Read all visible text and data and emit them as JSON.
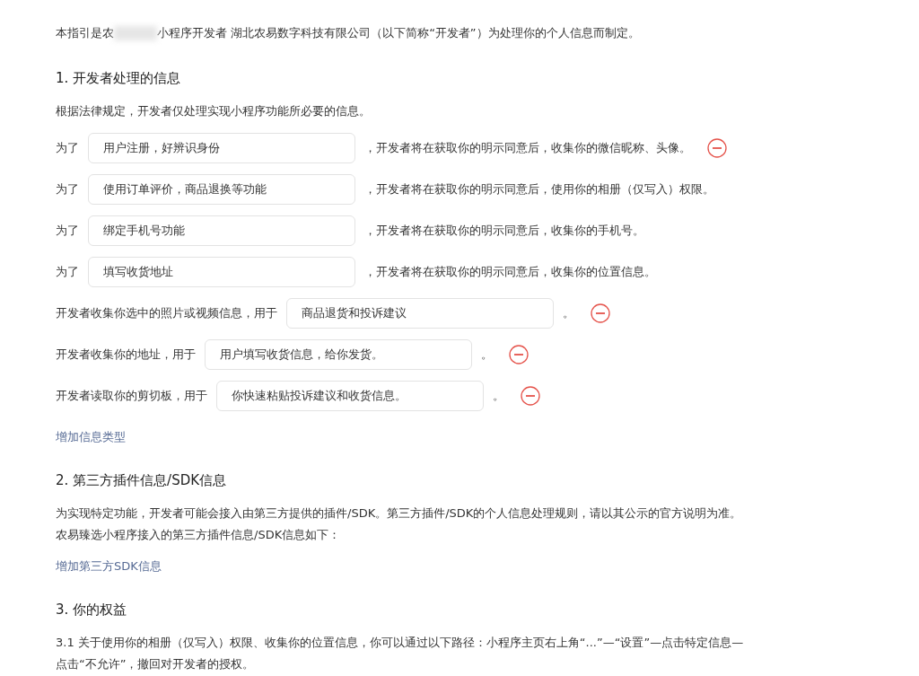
{
  "intro": {
    "before": "本指引是农",
    "after": "小程序开发者 湖北农易数字科技有限公司（以下简称“开发者”）为处理你的个人信息而制定。"
  },
  "sections": [
    {
      "heading": "1.  开发者处理的信息",
      "text": "根据法律规定，开发者仅处理实现小程序功能所必要的信息。",
      "rows": [
        {
          "prefix": "为了",
          "value": "用户注册，好辨识身份",
          "suffix": "，开发者将在获取你的明示同意后，收集你的微信昵称、头像。",
          "removable": true
        },
        {
          "prefix": "为了",
          "value": "使用订单评价，商品退换等功能",
          "suffix": "，开发者将在获取你的明示同意后，使用你的相册（仅写入）权限。",
          "removable": false
        },
        {
          "prefix": "为了",
          "value": "绑定手机号功能",
          "suffix": "，开发者将在获取你的明示同意后，收集你的手机号。",
          "removable": false
        },
        {
          "prefix": "为了",
          "value": "填写收货地址",
          "suffix": "，开发者将在获取你的明示同意后，收集你的位置信息。",
          "removable": false
        },
        {
          "prefix": "开发者收集你选中的照片或视频信息，用于",
          "value": "商品退货和投诉建议",
          "suffix": "。",
          "removable": true
        },
        {
          "prefix": "开发者收集你的地址，用于",
          "value": "用户填写收货信息，给你发货。",
          "suffix": "。",
          "removable": true
        },
        {
          "prefix": "开发者读取你的剪切板，用于",
          "value": "你快速粘贴投诉建议和收货信息。",
          "suffix": "。",
          "removable": true
        }
      ],
      "link": "增加信息类型"
    },
    {
      "heading": "2.  第三方插件信息/SDK信息",
      "text": "为实现特定功能，开发者可能会接入由第三方提供的插件/SDK。第三方插件/SDK的个人信息处理规则，请以其公示的官方说明为准。农易臻选小程序接入的第三方插件信息/SDK信息如下：",
      "link": "增加第三方SDK信息"
    },
    {
      "heading": "3.  你的权益",
      "text": "3.1   关于使用你的相册（仅写入）权限、收集你的位置信息，你可以通过以下路径：小程序主页右上角“...”—“设置”—点击特定信息—点击“不允许”，撤回对开发者的授权。"
    }
  ]
}
